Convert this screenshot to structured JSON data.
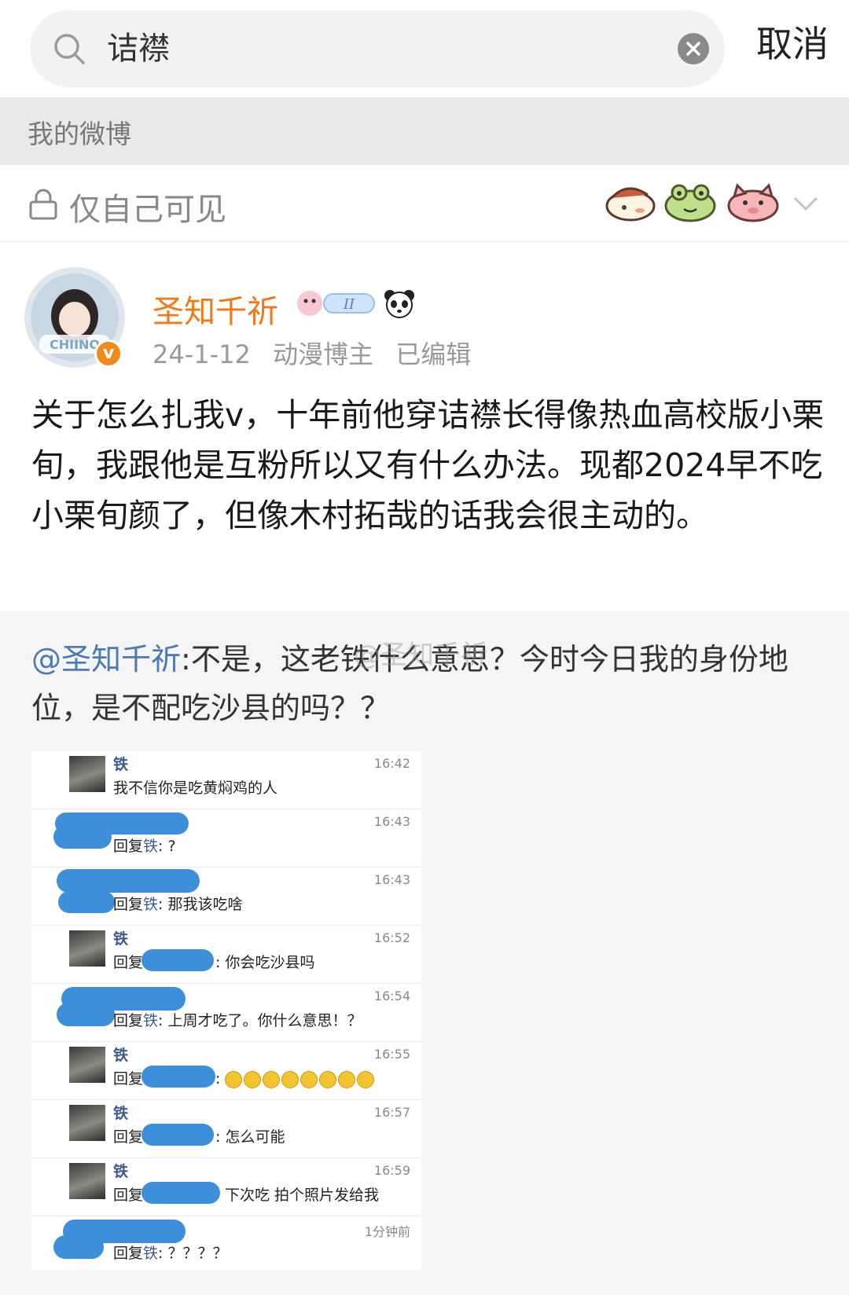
{
  "search": {
    "query": "诘襟",
    "cancel_label": "取消"
  },
  "section": {
    "title": "我的微博"
  },
  "visibility": {
    "label": "仅自己可见"
  },
  "post": {
    "author": "圣知千祈",
    "avatar_text": "CHIINO",
    "date": "24-1-12",
    "category": "动漫博主",
    "edited": "已编辑",
    "text": "关于怎么扎我v，十年前他穿诘襟长得像热血高校版小栗旬，我跟他是互粉所以又有什么办法。现都2024早不吃小栗旬颜了，但像木村拓哉的话我会很主动的。"
  },
  "repost": {
    "mention": "@圣知千祈",
    "text": ":不是，这老铁什么意思？今时今日我的身份地位，是不配吃沙县的吗？？",
    "watermark": "@圣知千祈"
  },
  "chat": {
    "rows": [
      {
        "name": "铁",
        "time": "16:42",
        "msg": "我不信你是吃黄焖鸡的人"
      },
      {
        "name": "",
        "time": "16:43",
        "reply_prefix": "回复",
        "reply_to": "铁",
        "msg": ": ?"
      },
      {
        "name": "",
        "time": "16:43",
        "reply_prefix": "回复",
        "reply_to": "铁",
        "msg": ": 那我该吃啥"
      },
      {
        "name": "铁",
        "time": "16:52",
        "reply_prefix": "回复",
        "msg": ": 你会吃沙县吗"
      },
      {
        "name": "",
        "time": "16:54",
        "reply_prefix": "回复",
        "reply_to": "铁",
        "msg": ": 上周才吃了。你什么意思！？"
      },
      {
        "name": "铁",
        "time": "16:55",
        "reply_prefix": "回复",
        "msg": ":"
      },
      {
        "name": "铁",
        "time": "16:57",
        "reply_prefix": "回复",
        "msg": ": 怎么可能"
      },
      {
        "name": "铁",
        "time": "16:59",
        "reply_prefix": "回复",
        "msg": "下次吃 拍个照片发给我"
      },
      {
        "name": "",
        "time": "1分钟前",
        "reply_prefix": "回复",
        "reply_to": "铁",
        "msg": ": ？？？？"
      }
    ]
  },
  "colors": {
    "author": "#f07a1a",
    "mention": "#4a7ab5",
    "redaction": "#3d8fd9"
  }
}
